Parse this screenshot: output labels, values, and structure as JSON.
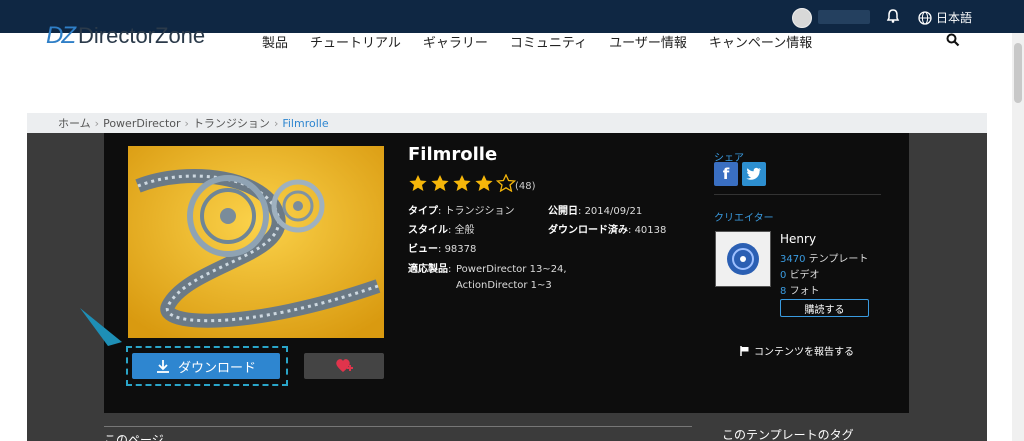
{
  "topbar": {
    "language": "日本語"
  },
  "header": {
    "logo_mark": "DZ",
    "logo_text": "DirectorZone",
    "nav": [
      "製品",
      "チュートリアル",
      "ギャラリー",
      "コミュニティ",
      "ユーザー情報",
      "キャンペーン情報"
    ]
  },
  "breadcrumb": [
    "ホーム",
    "PowerDirector",
    "トランジション",
    "Filmrolle"
  ],
  "item": {
    "title": "Filmrolle",
    "rating": 4,
    "rating_count": "(48)",
    "type_label": "タイプ",
    "type_value": "トランジション",
    "published_label": "公開日",
    "published_value": "2014/09/21",
    "style_label": "スタイル",
    "style_value": "全般",
    "downloads_label": "ダウンロード済み",
    "downloads_value": "40138",
    "views_label": "ビュー",
    "views_value": "98378",
    "products_label": "適応製品",
    "products_line1": "PowerDirector 13~24,",
    "products_line2": "ActionDirector 1~3"
  },
  "actions": {
    "download": "ダウンロード"
  },
  "share": {
    "label": "シェア"
  },
  "creator": {
    "label": "クリエイター",
    "name": "Henry",
    "templates_count": "3470",
    "templates_label": "テンプレート",
    "videos_count": "0",
    "videos_label": "ビデオ",
    "photos_count": "8",
    "photos_label": "フォト",
    "subscribe": "購読する",
    "report": "コンテンツを報告する"
  },
  "sections": {
    "this_page": "このページ",
    "tags": "このテンプレートのタグ"
  },
  "colors": {
    "topbar": "#0f2743",
    "accent": "#2e86d0",
    "panel": "#0d0d0d"
  }
}
